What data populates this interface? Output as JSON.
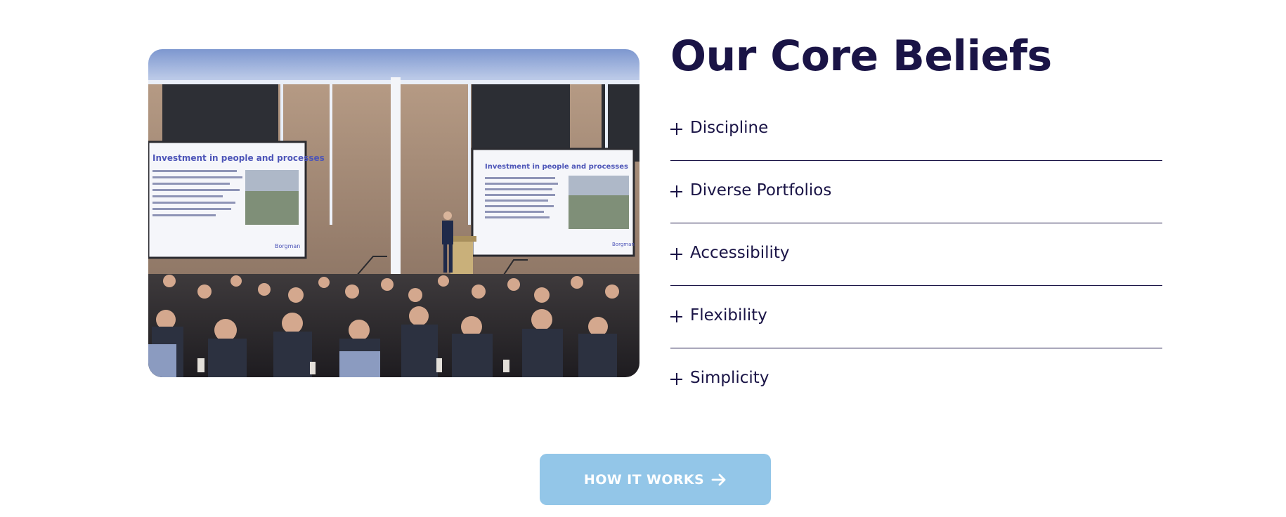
{
  "photo": {
    "alt": "Speaker presenting to a seated audience in a conference hall with two projection screens",
    "screen_heading": "Investment in people and processes",
    "screen_brand": "Borgman"
  },
  "section": {
    "title": "Our Core Beliefs"
  },
  "accordion": {
    "items": [
      {
        "label": "Discipline",
        "icon": "plus-icon"
      },
      {
        "label": "Diverse Portfolios",
        "icon": "plus-icon"
      },
      {
        "label": "Accessibility",
        "icon": "plus-icon"
      },
      {
        "label": "Flexibility",
        "icon": "plus-icon"
      },
      {
        "label": "Simplicity",
        "icon": "plus-icon"
      }
    ]
  },
  "cta": {
    "label": "HOW IT WORKS",
    "icon": "arrow-right-icon",
    "color": "#93c6e8"
  },
  "colors": {
    "heading": "#1a1446",
    "background": "#ffffff"
  }
}
